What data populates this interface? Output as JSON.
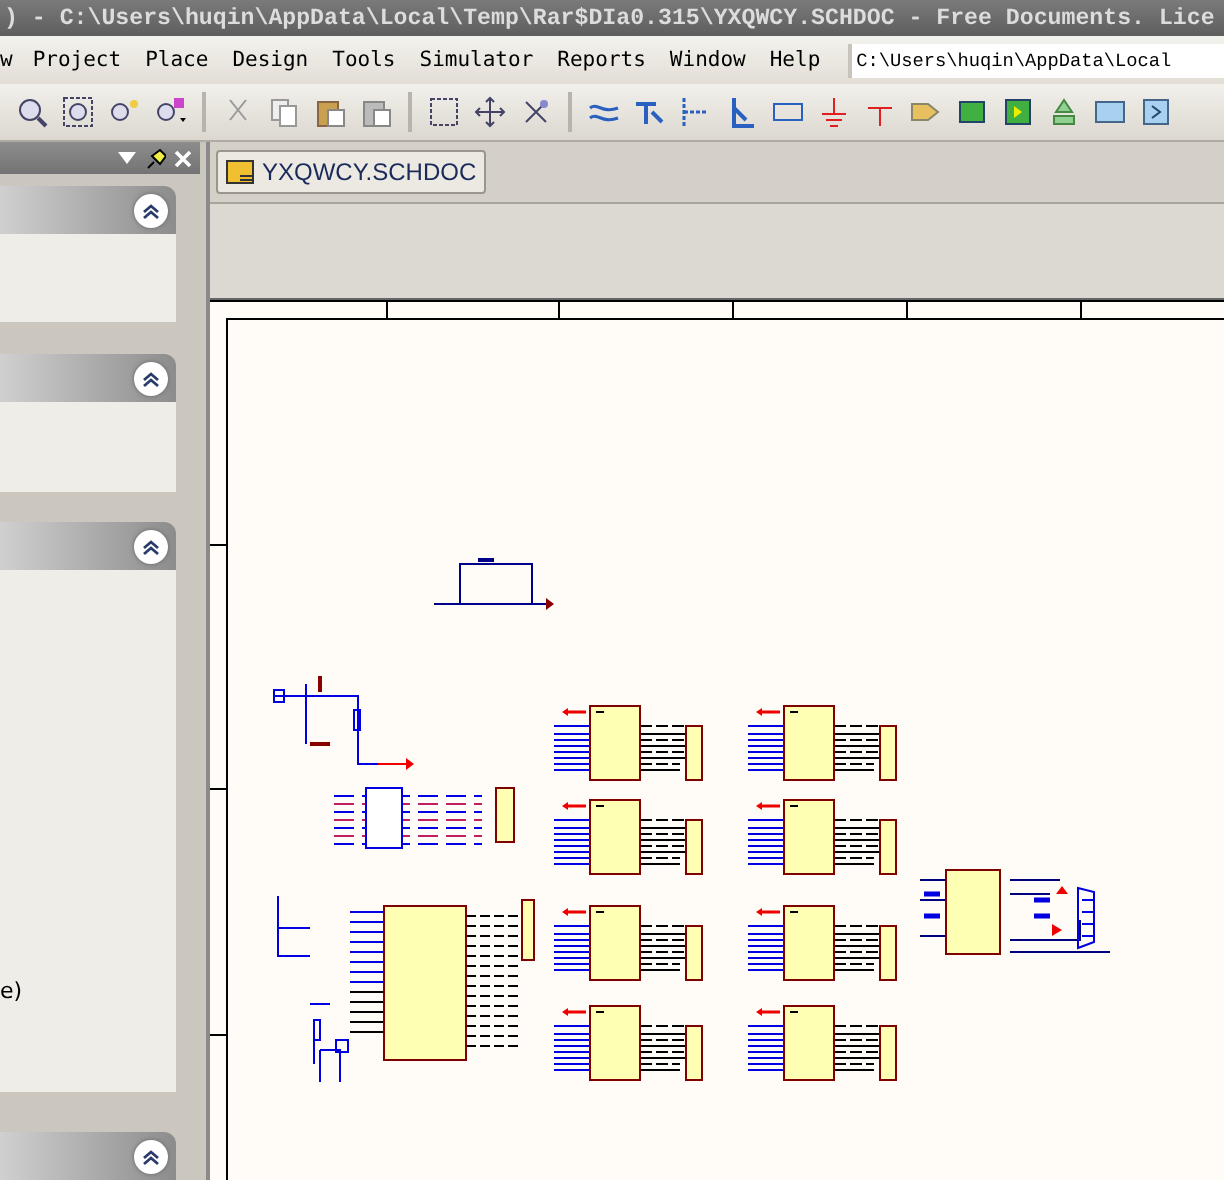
{
  "window": {
    "title": ") - C:\\Users\\huqin\\AppData\\Local\\Temp\\Rar$DIa0.315\\YXQWCY.SCHDOC - Free Documents. Lice"
  },
  "menu": [
    "w",
    "Project",
    "Place",
    "Design",
    "Tools",
    "Simulator",
    "Reports",
    "Window",
    "Help"
  ],
  "path_field": {
    "value": "C:\\Users\\huqin\\AppData\\Local"
  },
  "panel": {
    "sections": [
      {
        "expanded": true
      },
      {
        "expanded": true
      },
      {
        "expanded": true,
        "text": "e)"
      },
      {
        "expanded": true
      }
    ]
  },
  "document_tabs": [
    {
      "label": "YXQWCY.SCHDOC",
      "selected": true
    }
  ]
}
